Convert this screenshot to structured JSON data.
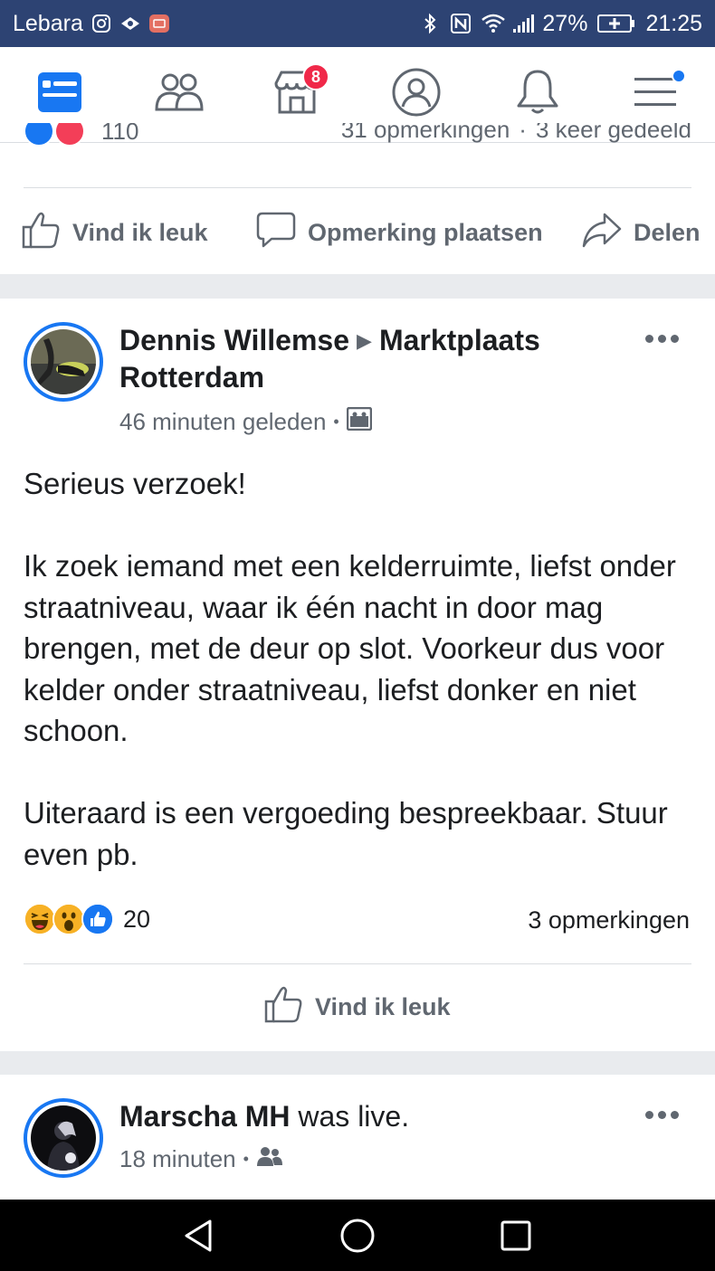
{
  "status_bar": {
    "carrier": "Lebara",
    "battery": "27%",
    "time": "21:25"
  },
  "nav": {
    "tabs": [
      {
        "name": "news-feed",
        "icon": "newsfeed-icon"
      },
      {
        "name": "friends",
        "icon": "friends-icon"
      },
      {
        "name": "marketplace",
        "icon": "marketplace-icon",
        "badge": "8"
      },
      {
        "name": "profile",
        "icon": "profile-icon"
      },
      {
        "name": "notifications",
        "icon": "bell-icon"
      },
      {
        "name": "menu",
        "icon": "hamburger-icon"
      }
    ],
    "accent": "#1877f2"
  },
  "previous_post": {
    "reaction_count": "110",
    "comments": "31 opmerkingen",
    "separator": "·",
    "shares": "3 keer gedeeld",
    "actions": {
      "like": "Vind ik leuk",
      "comment": "Opmerking plaatsen",
      "share": "Delen"
    }
  },
  "post": {
    "author": "Dennis Willemse",
    "group": "Marktplaats Rotterdam",
    "time": "46 minuten geleden",
    "separator": "•",
    "audience_icon": "group-icon",
    "text": "Serieus verzoek!\n\nIk zoek iemand met een kelderruimte, liefst onder straatniveau, waar ik één nacht in door mag brengen, met de deur op slot. Voorkeur dus voor kelder onder straatniveau, liefst donker en niet schoon.\n\nUiteraard is een vergoeding bespreekbaar. Stuur even pb.",
    "reactions": [
      "haha",
      "wow",
      "like"
    ],
    "reaction_count": "20",
    "comments": "3 opmerkingen",
    "like_label": "Vind ik leuk"
  },
  "next_post": {
    "author": "Marscha MH",
    "action": " was live.",
    "time": "18 minuten",
    "separator": "•",
    "audience_icon": "friends-icon"
  }
}
